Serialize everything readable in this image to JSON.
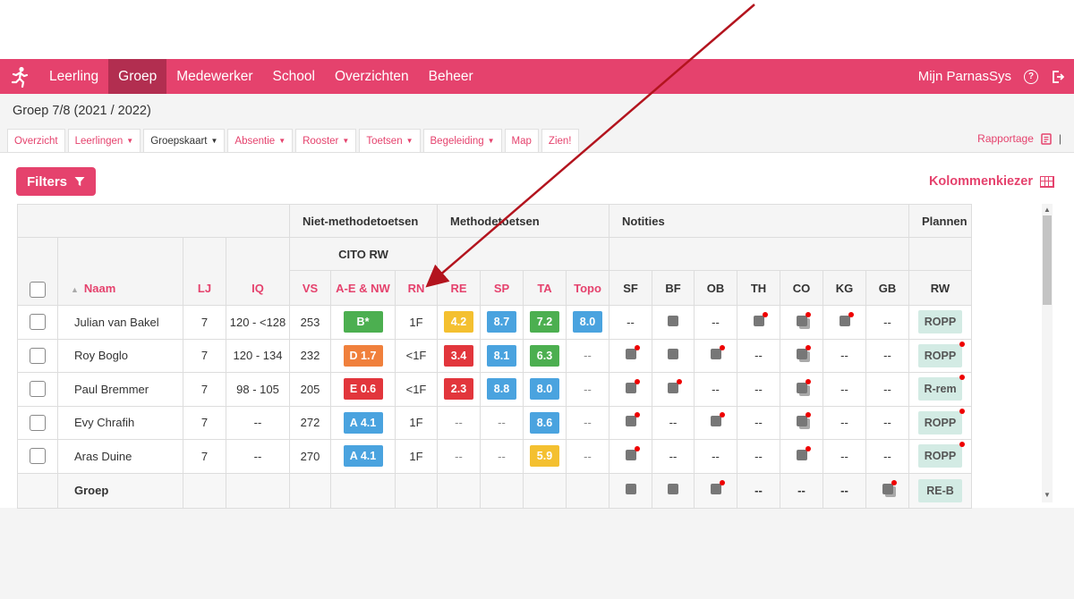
{
  "nav": {
    "items": [
      "Leerling",
      "Groep",
      "Medewerker",
      "School",
      "Overzichten",
      "Beheer"
    ],
    "active": "Groep",
    "user": "Mijn ParnasSys"
  },
  "group_title": "Groep 7/8 (2021 / 2022)",
  "tabs": [
    {
      "label": "Overzicht",
      "caret": false
    },
    {
      "label": "Leerlingen",
      "caret": true
    },
    {
      "label": "Groepskaart",
      "caret": true,
      "active": true
    },
    {
      "label": "Absentie",
      "caret": true
    },
    {
      "label": "Rooster",
      "caret": true
    },
    {
      "label": "Toetsen",
      "caret": true
    },
    {
      "label": "Begeleiding",
      "caret": true
    },
    {
      "label": "Map",
      "caret": false
    },
    {
      "label": "Zien!",
      "caret": false
    }
  ],
  "rapportage": "Rapportage",
  "filters_label": "Filters",
  "kolommenkiezer": "Kolommenkiezer",
  "table": {
    "group_headers": {
      "niet": "Niet-methodetoetsen",
      "methode": "Methodetoetsen",
      "notities": "Notities",
      "plannen": "Plannen"
    },
    "cito_header": "CITO RW",
    "columns": {
      "naam": "Naam",
      "lj": "LJ",
      "iq": "IQ",
      "vs": "VS",
      "ae": "A-E & NW",
      "rn": "RN",
      "re": "RE",
      "sp": "SP",
      "ta": "TA",
      "topo": "Topo",
      "sf": "SF",
      "bf": "BF",
      "ob": "OB",
      "th": "TH",
      "co": "CO",
      "kg": "KG",
      "gb": "GB",
      "rw": "RW"
    },
    "rows": [
      {
        "name": "Julian van Bakel",
        "lj": "7",
        "iq": "120 - <128",
        "vs": "253",
        "ae": {
          "text": "B*",
          "color": "g"
        },
        "rn": "1F",
        "re": {
          "text": "4.2",
          "color": "y"
        },
        "sp": {
          "text": "8.7",
          "color": "b"
        },
        "ta": {
          "text": "7.2",
          "color": "g"
        },
        "topo": {
          "text": "8.0",
          "color": "b"
        },
        "notes": {
          "sf": "--",
          "bf": "sq",
          "ob": "--",
          "th": "sqdot",
          "co": "stackdot",
          "kg": "sqdot",
          "gb": "--"
        },
        "plan": {
          "text": "ROPP",
          "dot": false
        }
      },
      {
        "name": "Roy Boglo",
        "lj": "7",
        "iq": "120 - 134",
        "vs": "232",
        "ae": {
          "text": "D 1.7",
          "color": "o"
        },
        "rn": "<1F",
        "re": {
          "text": "3.4",
          "color": "r"
        },
        "sp": {
          "text": "8.1",
          "color": "b"
        },
        "ta": {
          "text": "6.3",
          "color": "g"
        },
        "topo": {
          "text": "--",
          "color": ""
        },
        "notes": {
          "sf": "sqdot",
          "bf": "sq",
          "ob": "sqdot",
          "th": "--",
          "co": "stackdot",
          "kg": "--",
          "gb": "--"
        },
        "plan": {
          "text": "ROPP",
          "dot": true
        }
      },
      {
        "name": "Paul Bremmer",
        "lj": "7",
        "iq": "98 - 105",
        "vs": "205",
        "ae": {
          "text": "E 0.6",
          "color": "r"
        },
        "rn": "<1F",
        "re": {
          "text": "2.3",
          "color": "r"
        },
        "sp": {
          "text": "8.8",
          "color": "b"
        },
        "ta": {
          "text": "8.0",
          "color": "b"
        },
        "topo": {
          "text": "--",
          "color": ""
        },
        "notes": {
          "sf": "sqdot",
          "bf": "sqdot",
          "ob": "--",
          "th": "--",
          "co": "stackdot",
          "kg": "--",
          "gb": "--"
        },
        "plan": {
          "text": "R-rem",
          "dot": true
        }
      },
      {
        "name": "Evy Chrafih",
        "lj": "7",
        "iq": "--",
        "vs": "272",
        "ae": {
          "text": "A 4.1",
          "color": "b"
        },
        "rn": "1F",
        "re": {
          "text": "--",
          "color": ""
        },
        "sp": {
          "text": "--",
          "color": ""
        },
        "ta": {
          "text": "8.6",
          "color": "b"
        },
        "topo": {
          "text": "--",
          "color": ""
        },
        "notes": {
          "sf": "sqdot",
          "bf": "--",
          "ob": "sqdot",
          "th": "--",
          "co": "stackdot",
          "kg": "--",
          "gb": "--"
        },
        "plan": {
          "text": "ROPP",
          "dot": true
        }
      },
      {
        "name": "Aras Duine",
        "lj": "7",
        "iq": "--",
        "vs": "270",
        "ae": {
          "text": "A 4.1",
          "color": "b"
        },
        "rn": "1F",
        "re": {
          "text": "--",
          "color": ""
        },
        "sp": {
          "text": "--",
          "color": ""
        },
        "ta": {
          "text": "5.9",
          "color": "y"
        },
        "topo": {
          "text": "--",
          "color": ""
        },
        "notes": {
          "sf": "sqdot",
          "bf": "--",
          "ob": "--",
          "th": "--",
          "co": "sqdot",
          "kg": "--",
          "gb": "--"
        },
        "plan": {
          "text": "ROPP",
          "dot": true
        }
      }
    ],
    "groep_row": {
      "label": "Groep",
      "notes": {
        "sf": "sq",
        "bf": "sq",
        "ob": "sqdot",
        "th": "--",
        "co": "--",
        "kg": "--",
        "gb": "stackdot"
      },
      "plan": {
        "text": "RE-B",
        "dot": false
      }
    }
  },
  "colors": {
    "accent": "#e5426d",
    "arrow": "#b3141e"
  }
}
